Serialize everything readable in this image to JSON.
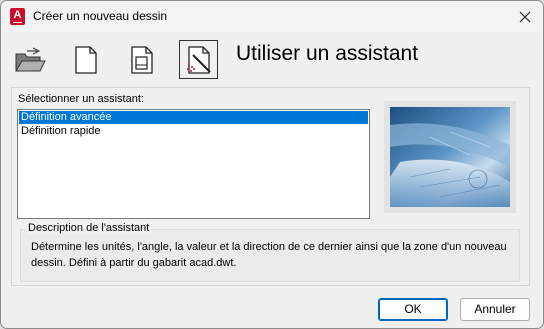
{
  "window": {
    "title": "Créer un nouveau dessin",
    "app_icon_letter": "A"
  },
  "toolbar": {
    "buttons": [
      {
        "name": "open-drawing",
        "icon": "open-folder-icon"
      },
      {
        "name": "start-from-scratch",
        "icon": "blank-page-icon"
      },
      {
        "name": "use-template",
        "icon": "template-page-icon"
      },
      {
        "name": "use-wizard",
        "icon": "wizard-icon",
        "active": true
      }
    ],
    "heading": "Utiliser un assistant"
  },
  "wizard_list": {
    "label": "Sélectionner un assistant:",
    "items": [
      {
        "label": "Définition avancée",
        "selected": true
      },
      {
        "label": "Définition rapide",
        "selected": false
      }
    ]
  },
  "description": {
    "legend": "Description de l'assistant",
    "text": "Détermine les unités, l'angle, la valeur et la direction de ce dernier ainsi que la zone d'un nouveau dessin. Défini à partir du gabarit acad.dwt."
  },
  "buttons": {
    "ok": "OK",
    "cancel": "Annuler"
  },
  "colors": {
    "selection": "#0078d7",
    "app_icon": "#c8102e"
  }
}
